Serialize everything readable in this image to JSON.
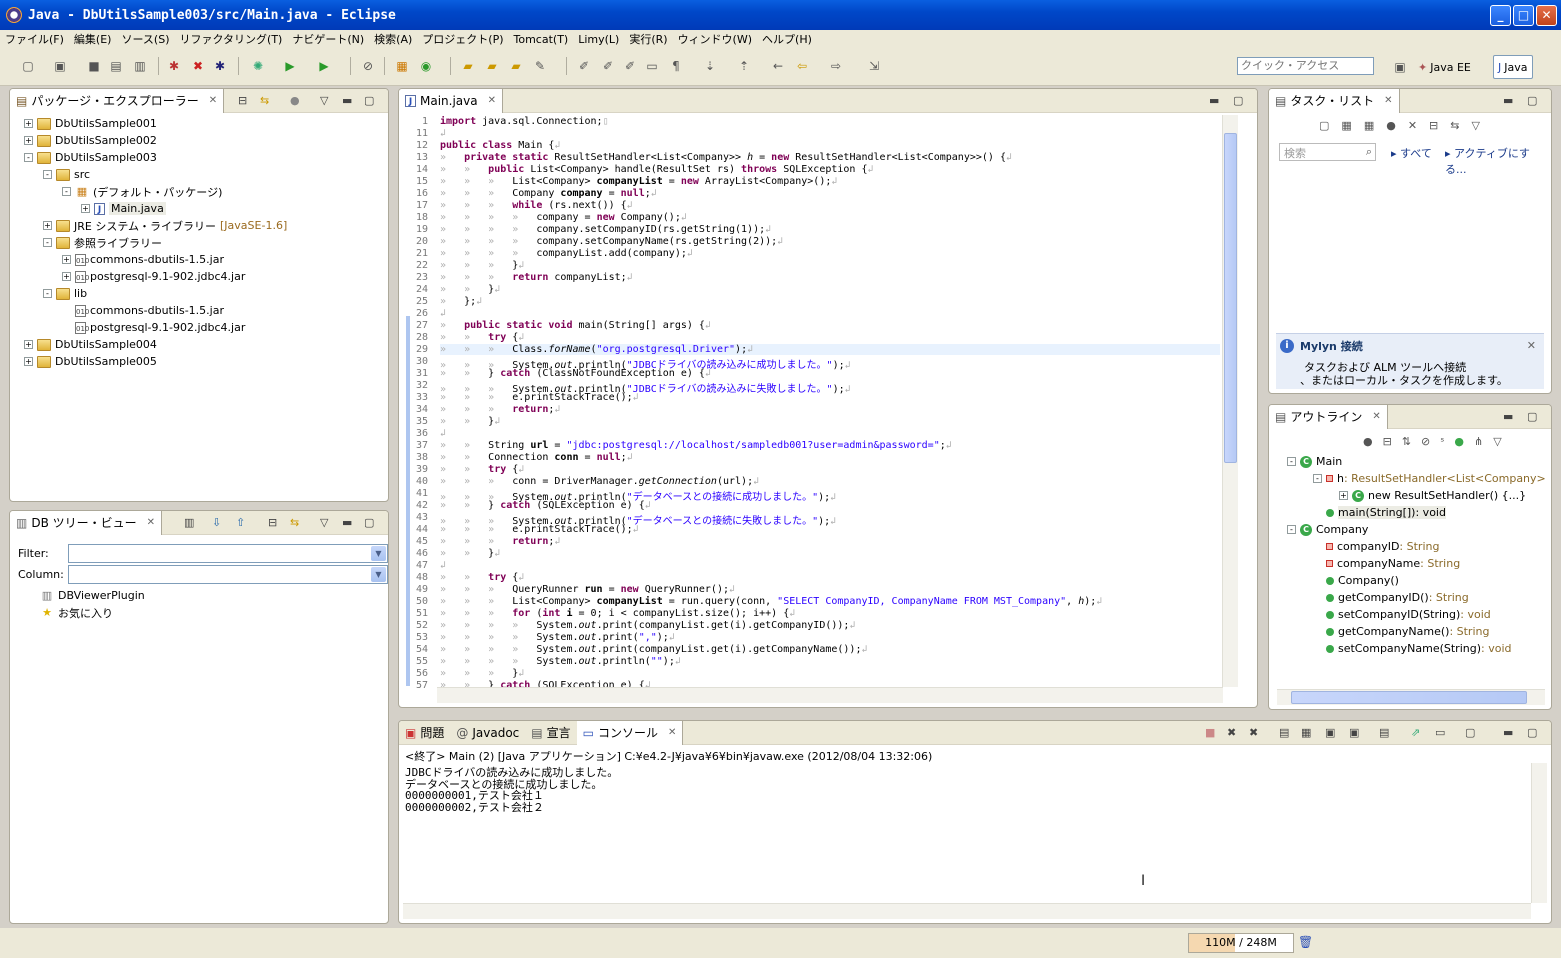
{
  "window": {
    "title": "Java - DbUtilsSample003/src/Main.java - Eclipse"
  },
  "menu": [
    "ファイル(F)",
    "編集(E)",
    "ソース(S)",
    "リファクタリング(T)",
    "ナビゲート(N)",
    "検索(A)",
    "プロジェクト(P)",
    "Tomcat(T)",
    "Limy(L)",
    "実行(R)",
    "ウィンドウ(W)",
    "ヘルプ(H)"
  ],
  "toolbar": {
    "quick_access_placeholder": "クイック・アクセス",
    "perspectives": [
      "Java EE",
      "Java"
    ]
  },
  "package_explorer": {
    "title": "パッケージ・エクスプローラー",
    "items": [
      {
        "label": "DbUtilsSample001",
        "depth": 0,
        "toggle": "+",
        "icon": "project-icon"
      },
      {
        "label": "DbUtilsSample002",
        "depth": 0,
        "toggle": "+",
        "icon": "project-icon"
      },
      {
        "label": "DbUtilsSample003",
        "depth": 0,
        "toggle": "-",
        "icon": "project-icon"
      },
      {
        "label": "src",
        "depth": 1,
        "toggle": "-",
        "icon": "source-folder-icon"
      },
      {
        "label": "(デフォルト・パッケージ)",
        "depth": 2,
        "toggle": "-",
        "icon": "package-icon"
      },
      {
        "label": "Main.java",
        "depth": 3,
        "toggle": "+",
        "icon": "java-file-icon"
      },
      {
        "label": "JRE システム・ライブラリー",
        "decor": "[JavaSE-1.6]",
        "depth": 1,
        "toggle": "+",
        "icon": "library-icon"
      },
      {
        "label": "参照ライブラリー",
        "depth": 1,
        "toggle": "-",
        "icon": "library-icon"
      },
      {
        "label": "commons-dbutils-1.5.jar",
        "depth": 2,
        "toggle": "+",
        "icon": "jar-icon"
      },
      {
        "label": "postgresql-9.1-902.jdbc4.jar",
        "depth": 2,
        "toggle": "+",
        "icon": "jar-icon"
      },
      {
        "label": "lib",
        "depth": 1,
        "toggle": "-",
        "icon": "folder-icon"
      },
      {
        "label": "commons-dbutils-1.5.jar",
        "depth": 2,
        "toggle": "",
        "icon": "jar-icon"
      },
      {
        "label": "postgresql-9.1-902.jdbc4.jar",
        "depth": 2,
        "toggle": "",
        "icon": "jar-icon"
      },
      {
        "label": "DbUtilsSample004",
        "depth": 0,
        "toggle": "+",
        "icon": "project-icon"
      },
      {
        "label": "DbUtilsSample005",
        "depth": 0,
        "toggle": "+",
        "icon": "project-icon"
      }
    ]
  },
  "db_tree": {
    "title": "DB ツリー・ビュー",
    "filter_label": "Filter:",
    "column_label": "Column:",
    "items": [
      "DBViewerPlugin",
      "お気に入り"
    ]
  },
  "editor": {
    "tab": "Main.java",
    "lines": [
      {
        "n": "1",
        "html": "<span class='k'>import</span> java.sql.Connection;<span class='p'>▯</span>"
      },
      {
        "n": "11",
        "html": "<span class='p'>↲</span>"
      },
      {
        "n": "12",
        "html": "<span class='k'>public class</span> Main {<span class='p'>↲</span>"
      },
      {
        "n": "13",
        "html": "<span class='p'>»</span>   <span class='k'>private static</span> ResultSetHandler&lt;List&lt;Company&gt;&gt; <span class='f it'>h</span> = <span class='k'>new</span> ResultSetHandler&lt;List&lt;Company&gt;&gt;() {<span class='p'>↲</span>"
      },
      {
        "n": "14",
        "html": "<span class='p'>»   »</span>   <span class='k'>public</span> List&lt;Company&gt; handle(ResultSet rs) <span class='k'>throws</span> SQLException {<span class='p'>↲</span>"
      },
      {
        "n": "15",
        "html": "<span class='p'>»   »   »</span>   List&lt;Company&gt; <b>companyList</b> = <span class='k'>new</span> ArrayList&lt;Company&gt;();<span class='p'>↲</span>"
      },
      {
        "n": "16",
        "html": "<span class='p'>»   »   »</span>   Company <b>company</b> = <span class='k'>null</span>;<span class='p'>↲</span>"
      },
      {
        "n": "17",
        "html": "<span class='p'>»   »   »</span>   <span class='k'>while</span> (rs.next()) {<span class='p'>↲</span>"
      },
      {
        "n": "18",
        "html": "<span class='p'>»   »   »   »</span>   company = <span class='k'>new</span> Company();<span class='p'>↲</span>"
      },
      {
        "n": "19",
        "html": "<span class='p'>»   »   »   »</span>   company.setCompanyID(rs.getString(1));<span class='p'>↲</span>"
      },
      {
        "n": "20",
        "html": "<span class='p'>»   »   »   »</span>   company.setCompanyName(rs.getString(2));<span class='p'>↲</span>"
      },
      {
        "n": "21",
        "html": "<span class='p'>»   »   »   »</span>   companyList.add(company);<span class='p'>↲</span>"
      },
      {
        "n": "22",
        "html": "<span class='p'>»   »   »</span>   }<span class='p'>↲</span>"
      },
      {
        "n": "23",
        "html": "<span class='p'>»   »   »</span>   <span class='k'>return</span> companyList;<span class='p'>↲</span>"
      },
      {
        "n": "24",
        "html": "<span class='p'>»   »</span>   }<span class='p'>↲</span>"
      },
      {
        "n": "25",
        "html": "<span class='p'>»</span>   };<span class='p'>↲</span>"
      },
      {
        "n": "26",
        "html": "<span class='p'>↲</span>"
      },
      {
        "n": "27",
        "html": "<span class='p'>»</span>   <span class='k'>public static void</span> main(String[] args) {<span class='p'>↲</span>"
      },
      {
        "n": "28",
        "html": "<span class='p'>»   »</span>   <span class='k'>try</span> {<span class='p'>↲</span>"
      },
      {
        "n": "29",
        "html": "<span class='p'>»   »   »</span>   Class.<span class='it'>forName</span>(<span class='s'>\"org.postgresql.Driver\"</span>);<span class='p'>↲</span>"
      },
      {
        "n": "30",
        "html": "<span class='p'>»   »   »</span>   System.<span class='f it'>out</span>.println(<span class='s'>\"JDBCドライバの読み込みに成功しました。\"</span>);<span class='p'>↲</span>"
      },
      {
        "n": "31",
        "html": "<span class='p'>»   »</span>   } <span class='k'>catch</span> (ClassNotFoundException e) {<span class='p'>↲</span>"
      },
      {
        "n": "32",
        "html": "<span class='p'>»   »   »</span>   System.<span class='f it'>out</span>.println(<span class='s'>\"JDBCドライバの読み込みに失敗しました。\"</span>);<span class='p'>↲</span>"
      },
      {
        "n": "33",
        "html": "<span class='p'>»   »   »</span>   e.printStackTrace();<span class='p'>↲</span>"
      },
      {
        "n": "34",
        "html": "<span class='p'>»   »   »</span>   <span class='k'>return</span>;<span class='p'>↲</span>"
      },
      {
        "n": "35",
        "html": "<span class='p'>»   »</span>   }<span class='p'>↲</span>"
      },
      {
        "n": "36",
        "html": "<span class='p'>↲</span>"
      },
      {
        "n": "37",
        "html": "<span class='p'>»   »</span>   String <b>url</b> = <span class='s'>\"jdbc:postgresql://localhost/sampledb001?user=admin&amp;password=\"</span>;<span class='p'>↲</span>"
      },
      {
        "n": "38",
        "html": "<span class='p'>»   »</span>   Connection <b>conn</b> = <span class='k'>null</span>;<span class='p'>↲</span>"
      },
      {
        "n": "39",
        "html": "<span class='p'>»   »</span>   <span class='k'>try</span> {<span class='p'>↲</span>"
      },
      {
        "n": "40",
        "html": "<span class='p'>»   »   »</span>   conn = DriverManager.<span class='it'>getConnection</span>(url);<span class='p'>↲</span>"
      },
      {
        "n": "41",
        "html": "<span class='p'>»   »   »</span>   System.<span class='f it'>out</span>.println(<span class='s'>\"データベースとの接続に成功しました。\"</span>);<span class='p'>↲</span>"
      },
      {
        "n": "42",
        "html": "<span class='p'>»   »</span>   } <span class='k'>catch</span> (SQLException e) {<span class='p'>↲</span>"
      },
      {
        "n": "43",
        "html": "<span class='p'>»   »   »</span>   System.<span class='f it'>out</span>.println(<span class='s'>\"データベースとの接続に失敗しました。\"</span>);<span class='p'>↲</span>"
      },
      {
        "n": "44",
        "html": "<span class='p'>»   »   »</span>   e.printStackTrace();<span class='p'>↲</span>"
      },
      {
        "n": "45",
        "html": "<span class='p'>»   »   »</span>   <span class='k'>return</span>;<span class='p'>↲</span>"
      },
      {
        "n": "46",
        "html": "<span class='p'>»   »</span>   }<span class='p'>↲</span>"
      },
      {
        "n": "47",
        "html": "<span class='p'>↲</span>"
      },
      {
        "n": "48",
        "html": "<span class='p'>»   »</span>   <span class='k'>try</span> {<span class='p'>↲</span>"
      },
      {
        "n": "49",
        "html": "<span class='p'>»   »   »</span>   QueryRunner <b>run</b> = <span class='k'>new</span> QueryRunner();<span class='p'>↲</span>"
      },
      {
        "n": "50",
        "html": "<span class='p'>»   »   »</span>   List&lt;Company&gt; <b>companyList</b> = run.query(conn, <span class='s'>\"SELECT CompanyID, CompanyName FROM MST_Company\"</span>, <span class='f it'>h</span>);<span class='p'>↲</span>"
      },
      {
        "n": "51",
        "html": "<span class='p'>»   »   »</span>   <span class='k'>for</span> (<span class='k'>int</span> <b>i</b> = 0; i &lt; companyList.size(); i++) {<span class='p'>↲</span>"
      },
      {
        "n": "52",
        "html": "<span class='p'>»   »   »   »</span>   System.<span class='f it'>out</span>.print(companyList.get(i).getCompanyID());<span class='p'>↲</span>"
      },
      {
        "n": "53",
        "html": "<span class='p'>»   »   »   »</span>   System.<span class='f it'>out</span>.print(<span class='s'>\",\"</span>);<span class='p'>↲</span>"
      },
      {
        "n": "54",
        "html": "<span class='p'>»   »   »   »</span>   System.<span class='f it'>out</span>.print(companyList.get(i).getCompanyName());<span class='p'>↲</span>"
      },
      {
        "n": "55",
        "html": "<span class='p'>»   »   »   »</span>   System.<span class='f it'>out</span>.println(<span class='s'>\"\"</span>);<span class='p'>↲</span>"
      },
      {
        "n": "56",
        "html": "<span class='p'>»   »   »</span>   }<span class='p'>↲</span>"
      },
      {
        "n": "57",
        "html": "<span class='p'>»   »</span>   } <span class='k'>catch</span> (SQLException e) {<span class='p'>↲</span>"
      }
    ]
  },
  "tasks": {
    "title": "タスク・リスト",
    "search_placeholder": "検索",
    "filter_all": "すべて",
    "filter_active": "アクティブにする...",
    "mylyn_title": "Mylyn 接続",
    "mylyn_line1": "タスクおよび ALM ツールへ接続",
    "mylyn_line2": "、またはローカル・タスクを作成します。"
  },
  "outline": {
    "title": "アウトライン",
    "items": [
      {
        "label": "Main",
        "type": "",
        "depth": 0,
        "kind": "class"
      },
      {
        "label": "h",
        "type": " : ResultSetHandler<List<Company>",
        "depth": 1,
        "kind": "field-static"
      },
      {
        "label": "new ResultSetHandler() {...}",
        "type": "",
        "depth": 2,
        "kind": "anon"
      },
      {
        "label": "main(String[])",
        "type": " : void",
        "depth": 1,
        "kind": "method-static"
      },
      {
        "label": "Company",
        "type": "",
        "depth": 0,
        "kind": "class"
      },
      {
        "label": "companyID",
        "type": " : String",
        "depth": 1,
        "kind": "field"
      },
      {
        "label": "companyName",
        "type": " : String",
        "depth": 1,
        "kind": "field"
      },
      {
        "label": "Company()",
        "type": "",
        "depth": 1,
        "kind": "ctor"
      },
      {
        "label": "getCompanyID()",
        "type": " : String",
        "depth": 1,
        "kind": "method"
      },
      {
        "label": "setCompanyID(String)",
        "type": " : void",
        "depth": 1,
        "kind": "method"
      },
      {
        "label": "getCompanyName()",
        "type": " : String",
        "depth": 1,
        "kind": "method"
      },
      {
        "label": "setCompanyName(String)",
        "type": " : void",
        "depth": 1,
        "kind": "method"
      }
    ]
  },
  "console": {
    "tabs": [
      "問題",
      "Javadoc",
      "宣言",
      "コンソール"
    ],
    "header": "<終了> Main (2) [Java アプリケーション] C:¥e4.2-J¥java¥6¥bin¥javaw.exe (2012/08/04 13:32:06)",
    "lines": [
      "JDBCドライバの読み込みに成功しました。",
      "データベースとの接続に成功しました。",
      "0000000001,テスト会社１",
      "0000000002,テスト会社２"
    ]
  },
  "status": {
    "heap": "110M / 248M",
    "heap_used_fraction": 0.444
  }
}
